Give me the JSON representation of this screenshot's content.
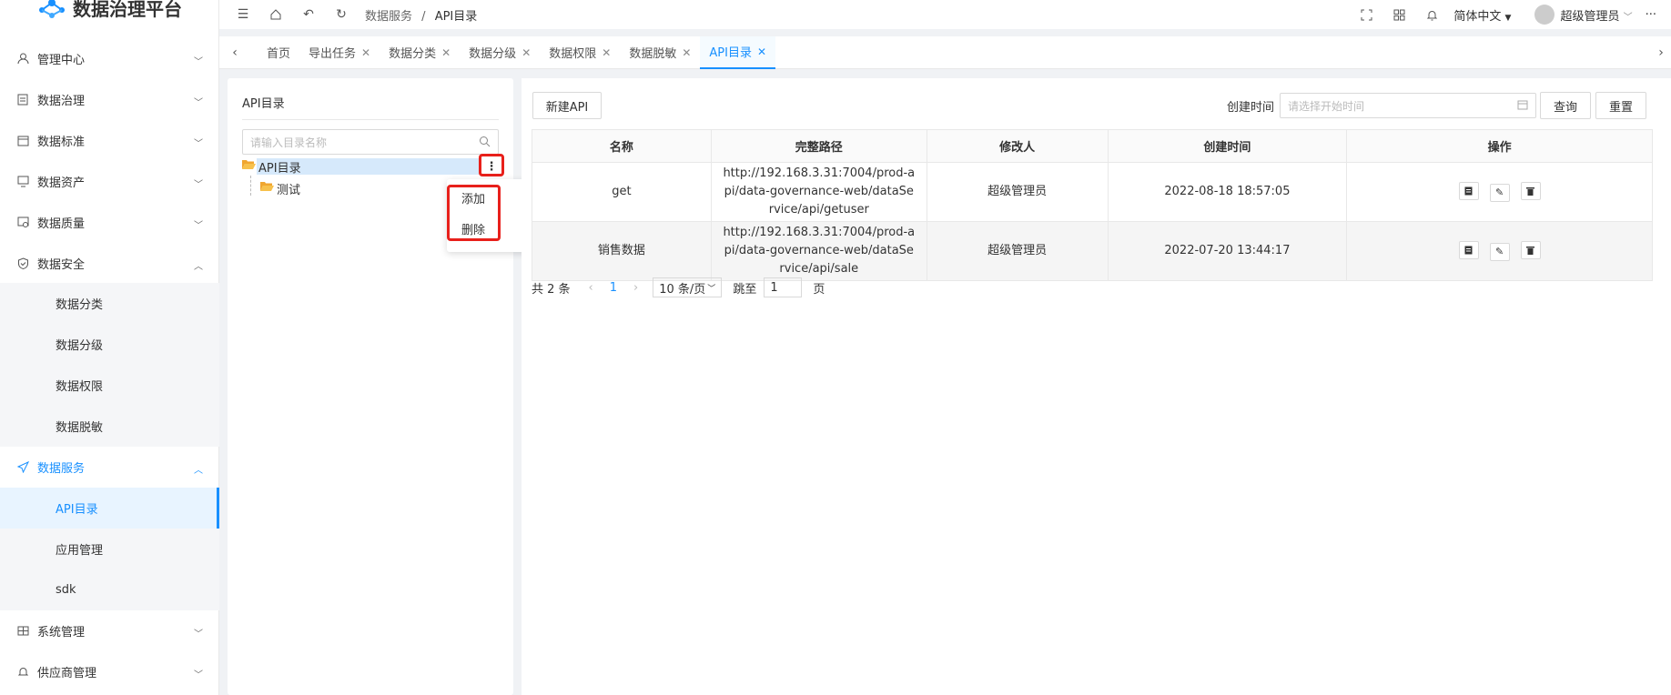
{
  "app": {
    "title": "数据治理平台"
  },
  "header": {
    "breadcrumb_parent": "数据服务",
    "breadcrumb_sep": "/",
    "breadcrumb_current": "API目录",
    "language": "简体中文",
    "user": "超级管理员",
    "more": "···"
  },
  "menu": {
    "m1": "管理中心",
    "m2": "数据治理",
    "m3": "数据标准",
    "m4": "数据资产",
    "m5": "数据质量",
    "m6": "数据安全",
    "s1": "数据分类",
    "s2": "数据分级",
    "s3": "数据权限",
    "s4": "数据脱敏",
    "m7": "数据服务",
    "s5": "API目录",
    "s6": "应用管理",
    "s7": "sdk",
    "m8": "系统管理",
    "m9": "供应商管理"
  },
  "tabs": [
    "首页",
    "导出任务",
    "数据分类",
    "数据分级",
    "数据权限",
    "数据脱敏",
    "API目录"
  ],
  "left": {
    "title": "API目录",
    "search_placeholder": "请输入目录名称",
    "root": "API目录",
    "child": "测试",
    "ctx_add": "添加",
    "ctx_delete": "删除"
  },
  "toolbar": {
    "new_api": "新建API",
    "created_label": "创建时间",
    "date_placeholder": "请选择开始时间",
    "query": "查询",
    "reset": "重置"
  },
  "table": {
    "headers": [
      "名称",
      "完整路径",
      "修改人",
      "创建时间",
      "操作"
    ],
    "rows": [
      {
        "name": "get",
        "path1": "http://192.168.3.31:7004/prod-a",
        "path2": "pi/data-governance-web/dataSe",
        "path3": "rvice/api/getuser",
        "modifier": "超级管理员",
        "created": "2022-08-18 18:57:05"
      },
      {
        "name": "销售数据",
        "path1": "http://192.168.3.31:7004/prod-a",
        "path2": "pi/data-governance-web/dataSe",
        "path3": "rvice/api/sale",
        "modifier": "超级管理员",
        "created": "2022-07-20 13:44:17"
      }
    ]
  },
  "pager": {
    "total": "共 2 条",
    "page": "1",
    "page_size": "10 条/页",
    "jump_label": "跳至",
    "jump_value": "1",
    "page_suffix": "页"
  },
  "colors": {
    "accent": "#1890ff",
    "highlight": "#e8201b"
  }
}
